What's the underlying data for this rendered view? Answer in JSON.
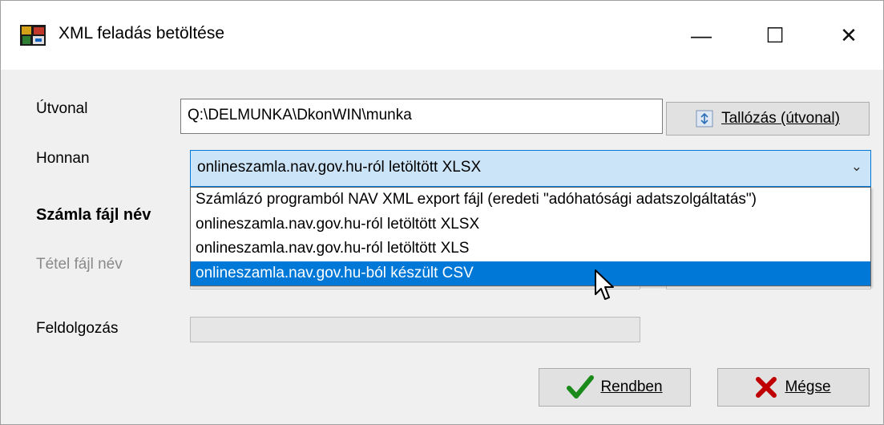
{
  "window": {
    "title": "XML feladás betöltése",
    "minimize_glyph": "—",
    "maximize_glyph": "☐",
    "close_glyph": "✕"
  },
  "form": {
    "path_label": "Útvonal",
    "path_value": "Q:\\DELMUNKA\\DkonWIN\\munka",
    "browse_label": "Tallózás (útvonal)",
    "source_label": "Honnan",
    "source_value": "onlineszamla.nav.gov.hu-ról letöltött XLSX",
    "invoice_file_label": "Számla fájl név",
    "item_file_label": "Tétel fájl név",
    "processing_label": "Feldolgozás"
  },
  "dropdown": {
    "options": [
      "Számlázó programból NAV XML export fájl (eredeti \"adóhatósági adatszolgáltatás\")",
      "onlineszamla.nav.gov.hu-ról letöltött XLSX",
      "onlineszamla.nav.gov.hu-ról letöltött XLS",
      "onlineszamla.nav.gov.hu-ból készült CSV"
    ],
    "selected_index": 3
  },
  "buttons": {
    "ok": "Rendben",
    "cancel": "Mégse"
  },
  "icons": {
    "app": "app-icon",
    "browse": "folder-browse-icon",
    "ok": "checkmark-icon",
    "cancel": "x-mark-icon",
    "cursor": "mouse-pointer-icon"
  },
  "colors": {
    "selection": "#0078d7",
    "combo_bg": "#cce4f7",
    "ok_icon": "#1a8a1a",
    "cancel_icon": "#c00000"
  }
}
